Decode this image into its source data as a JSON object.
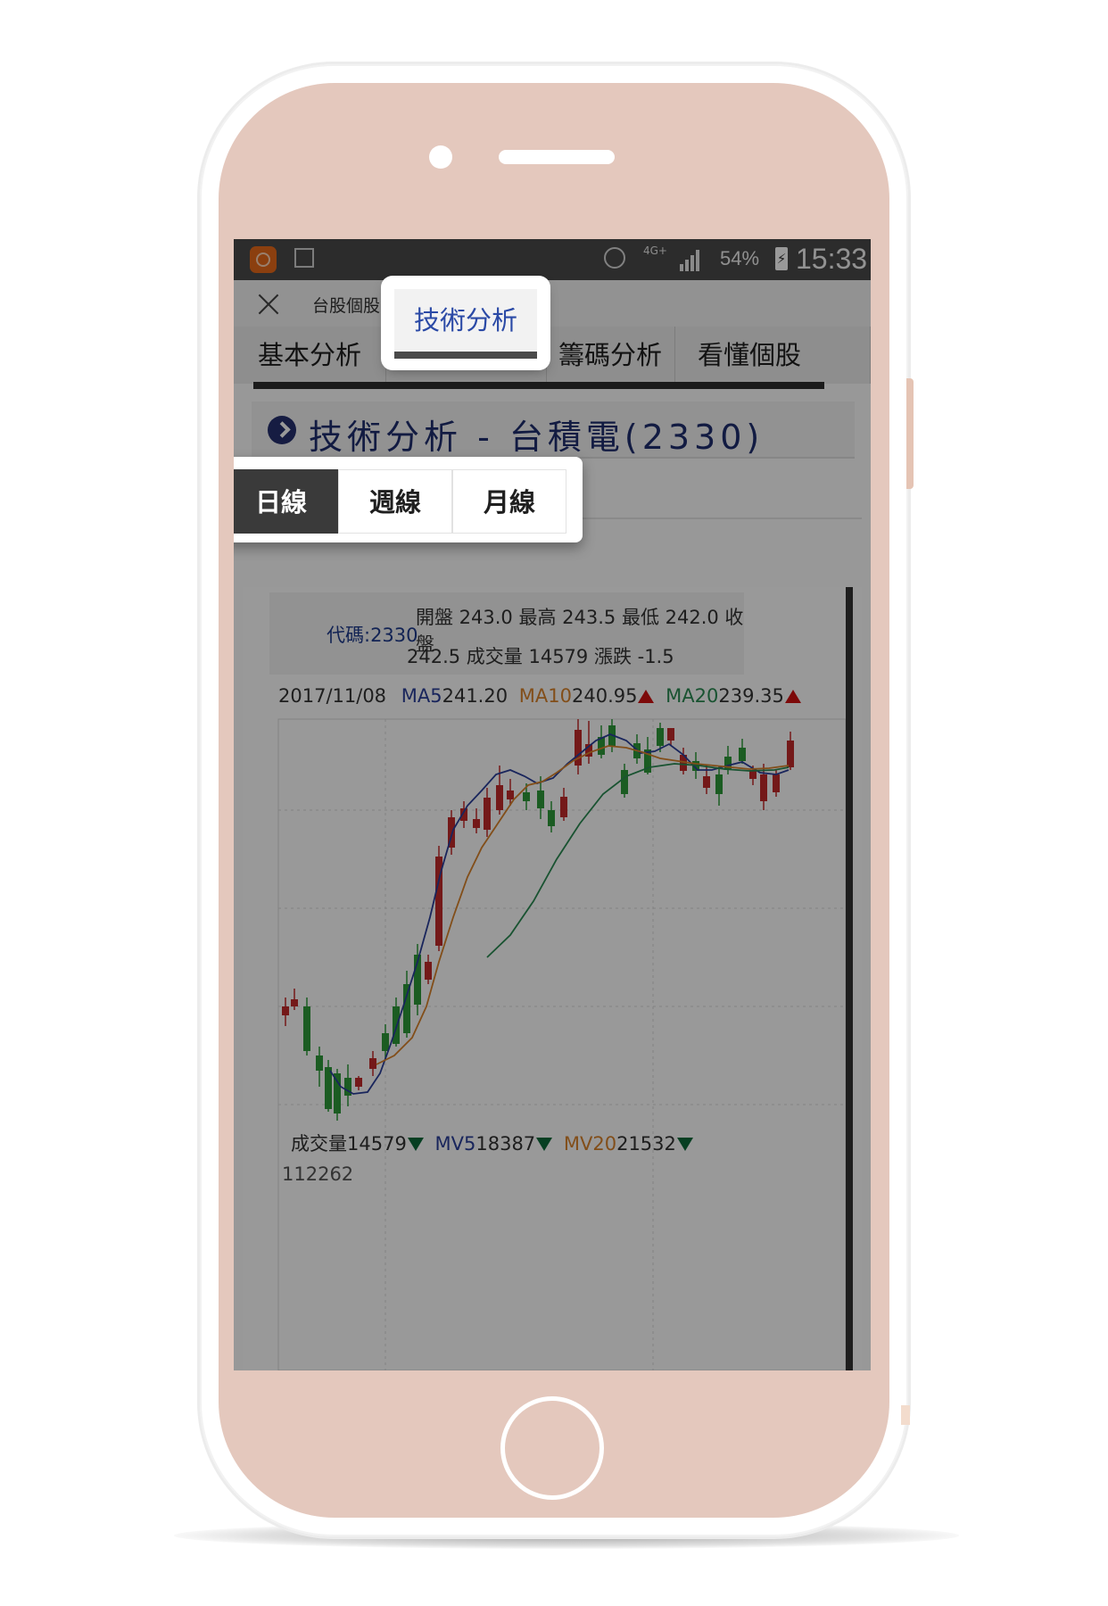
{
  "status_bar": {
    "network": "4G+",
    "battery_percent": "54%",
    "battery_symbol": "⚡",
    "time": "15:33"
  },
  "toolbar": {
    "title": "台股個股"
  },
  "tabs": [
    {
      "label": "基本分析"
    },
    {
      "label": "技術分析",
      "active": true
    },
    {
      "label": "籌碼分析"
    },
    {
      "label": "看懂個股"
    }
  ],
  "section": {
    "title": "技術分析 - 台積電(2330)"
  },
  "period_tabs": [
    {
      "label": "日線",
      "active": true
    },
    {
      "label": "週線"
    },
    {
      "label": "月線"
    }
  ],
  "quote": {
    "code": "代碼:2330",
    "line1": "開盤 243.0 最高 243.5 最低 242.0 收盤",
    "line2": "242.5 成交量 14579 漲跌 -1.5"
  },
  "ma": {
    "date": "2017/11/08",
    "ma5_label": "MA5",
    "ma5": "241.20",
    "ma10_label": "MA10",
    "ma10": "240.95",
    "ma20_label": "MA20",
    "ma20": "239.35"
  },
  "volume": {
    "label": "成交量14579",
    "mv5_label": "MV5",
    "mv5": "18387",
    "mv20_label": "MV20",
    "mv20": "21532",
    "axis_max": "112262"
  },
  "colors": {
    "up": "#c22a2a",
    "down": "#2e9a3a",
    "ma5": "#2a3f9a",
    "ma10": "#d9822b",
    "ma20": "#2a8a52",
    "highlight_text": "#2b4aa6"
  }
}
